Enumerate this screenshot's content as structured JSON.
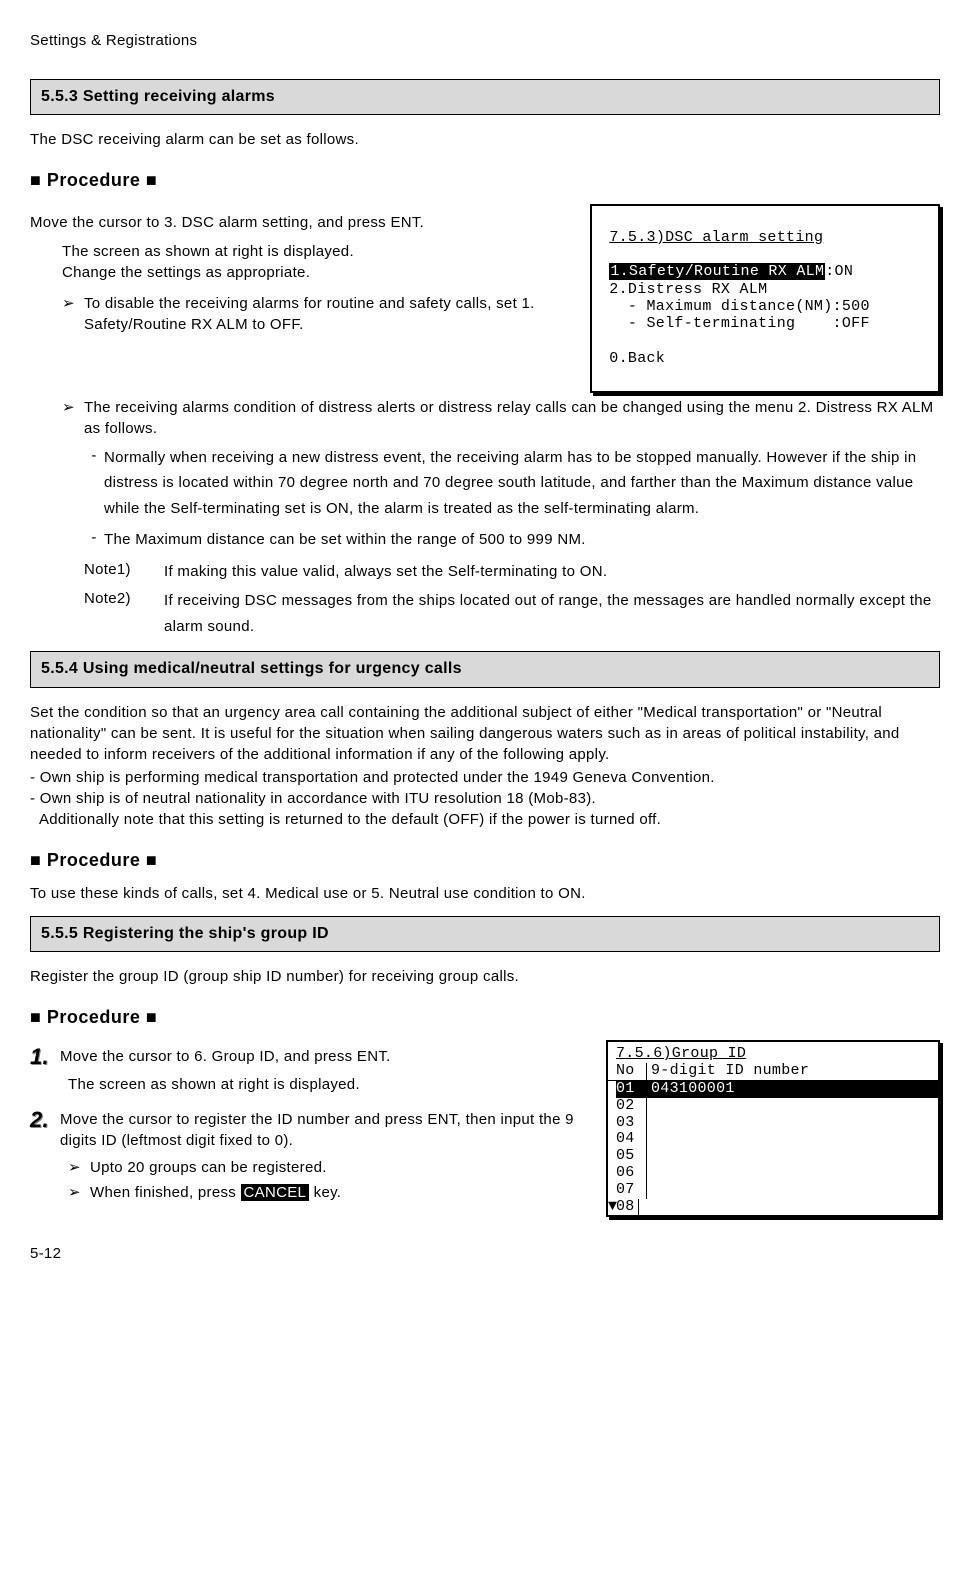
{
  "header": "Settings & Registrations",
  "pageNum": "5-12",
  "sec553": {
    "bar": "5.5.3        Setting receiving alarms",
    "intro": "The DSC receiving alarm can be set as follows.",
    "procHead": "■ Procedure ■",
    "p1": "Move the cursor to 3. DSC alarm setting, and press ENT.",
    "p2a": "The screen as shown at right is displayed.",
    "p2b": "Change the settings as appropriate.",
    "b1mk": "➢",
    "b1": "To disable the receiving alarms for routine and safety calls, set 1. Safety/Routine RX ALM to OFF.",
    "b2mk": "➢",
    "b2": "The receiving alarms condition of distress alerts or distress relay calls can be changed using the menu 2. Distress RX ALM as follows.",
    "d1mk": "-",
    "d1": "Normally when receiving a new distress event, the receiving alarm has to be stopped manually. However if the ship in distress is located within 70 degree north and 70 degree south latitude, and farther than the Maximum distance value while the Self-terminating set is ON, the alarm is treated as the self-terminating alarm.",
    "d2mk": "-",
    "d2": "The Maximum distance can be set within the range of 500 to 999 NM.",
    "n1l": "Note1)",
    "n1": "If making this value valid, always set the Self-terminating to ON.",
    "n2l": "Note2)",
    "n2": "If receiving DSC messages from the ships located out of range, the messages are handled normally except the alarm sound."
  },
  "screen1": {
    "title": "7.5.3)DSC alarm setting",
    "l1a": "1.Safety/Routine RX ALM",
    "l1b": ":ON",
    "l2": " 2.Distress RX ALM",
    "l3": "   - Maximum distance(NM):500",
    "l4": "   - Self-terminating    :OFF",
    "l5": " 0.Back"
  },
  "sec554": {
    "bar": "5.5.4        Using medical/neutral settings for urgency calls",
    "p1": "Set the condition so that an urgency area call containing the additional subject of either \"Medical transportation\" or \"Neutral nationality\" can be sent. It is useful for the situation when sailing dangerous waters such as in areas of political instability, and needed to inform receivers of the additional information if any of the following apply.",
    "p2": "- Own ship is performing medical transportation and protected under the 1949 Geneva Convention.",
    "p3": "- Own ship is of neutral nationality in accordance with ITU resolution 18 (Mob-83).",
    "p4": "  Additionally note that this setting is returned to the default (OFF) if the power is turned off.",
    "procHead": "■ Procedure ■",
    "p5": "To use these kinds of calls, set 4. Medical use or 5. Neutral use condition to ON."
  },
  "sec555": {
    "bar": "5.5.5        Registering the ship's group ID",
    "intro": "Register the group ID (group ship ID number) for receiving group calls.",
    "procHead": "■ Procedure ■",
    "s1num": "1.",
    "s1": "Move the cursor to 6. Group ID, and press ENT.",
    "s1sub": "The screen as shown at right is displayed.",
    "s2num": "2.",
    "s2": "Move the cursor to register the ID number and press ENT, then input the 9 digits ID (leftmost digit fixed to 0).",
    "b1mk": "➢",
    "b1": "Upto 20 groups can be registered.",
    "b2mk": "➢",
    "b2a": "When finished, press ",
    "b2key": "CANCEL",
    "b2b": " key."
  },
  "screen2": {
    "title": "7.5.6)Group ID",
    "hNo": "No",
    "hId": "9-digit ID number",
    "rows": [
      {
        "no": "01",
        "id": "043100001",
        "sel": true
      },
      {
        "no": "02",
        "id": ""
      },
      {
        "no": "03",
        "id": ""
      },
      {
        "no": "04",
        "id": ""
      },
      {
        "no": "05",
        "id": ""
      },
      {
        "no": "06",
        "id": ""
      },
      {
        "no": "07",
        "id": ""
      }
    ],
    "lastArrow": "▼",
    "lastNo": "08"
  }
}
